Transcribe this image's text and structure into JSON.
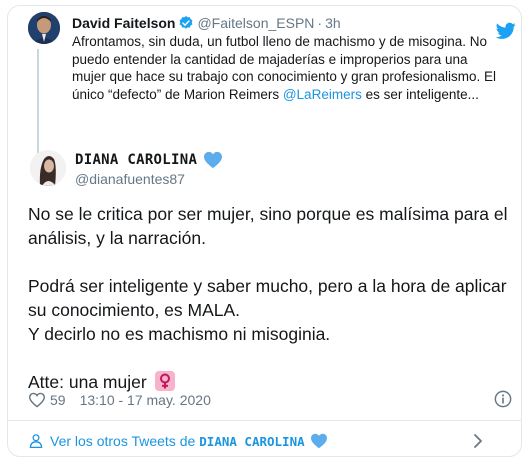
{
  "parent_tweet": {
    "author_name": "David Faitelson",
    "handle": "@Faitelson_ESPN",
    "separator": "·",
    "time": "3h",
    "text_before_mention": "Afrontamos, sin duda, un futbol lleno de machismo y de misogina. No puedo entender la cantidad de majaderías e improperios para una mujer que hace su trabajo con conocimiento y gran profesionalismo. El único “defecto” de Marion Reimers ",
    "mention": "@LaReimers",
    "text_after_mention": " es ser inteligente...",
    "verified_icon": "verified-badge-icon",
    "logo_icon": "twitter-bird-icon"
  },
  "reply_tweet": {
    "author_name": "DIANA CAROLINA",
    "handle": "@dianafuentes87",
    "name_emoji": "blue-heart-icon",
    "paragraphs": [
      "No se le critica por ser mujer, sino porque es malísima para el análisis, y la narración.",
      "Podrá ser inteligente y saber mucho, pero a la hora de aplicar su conocimiento, es MALA.",
      "Y decirlo no es machismo ni misoginia.",
      "Atte: una mujer"
    ],
    "closing_emoji": "female-sign-icon",
    "like_count": "59",
    "timestamp": "13:10 - 17 may. 2020"
  },
  "footer": {
    "label": "Ver los otros Tweets de",
    "name": "DIANA CAROLINA"
  },
  "colors": {
    "link": "#1b95e0",
    "muted": "#657786",
    "border": "#e1e8ed",
    "heart_blue": "#5dadec",
    "female_sign_bg": "#f7b3cc"
  }
}
